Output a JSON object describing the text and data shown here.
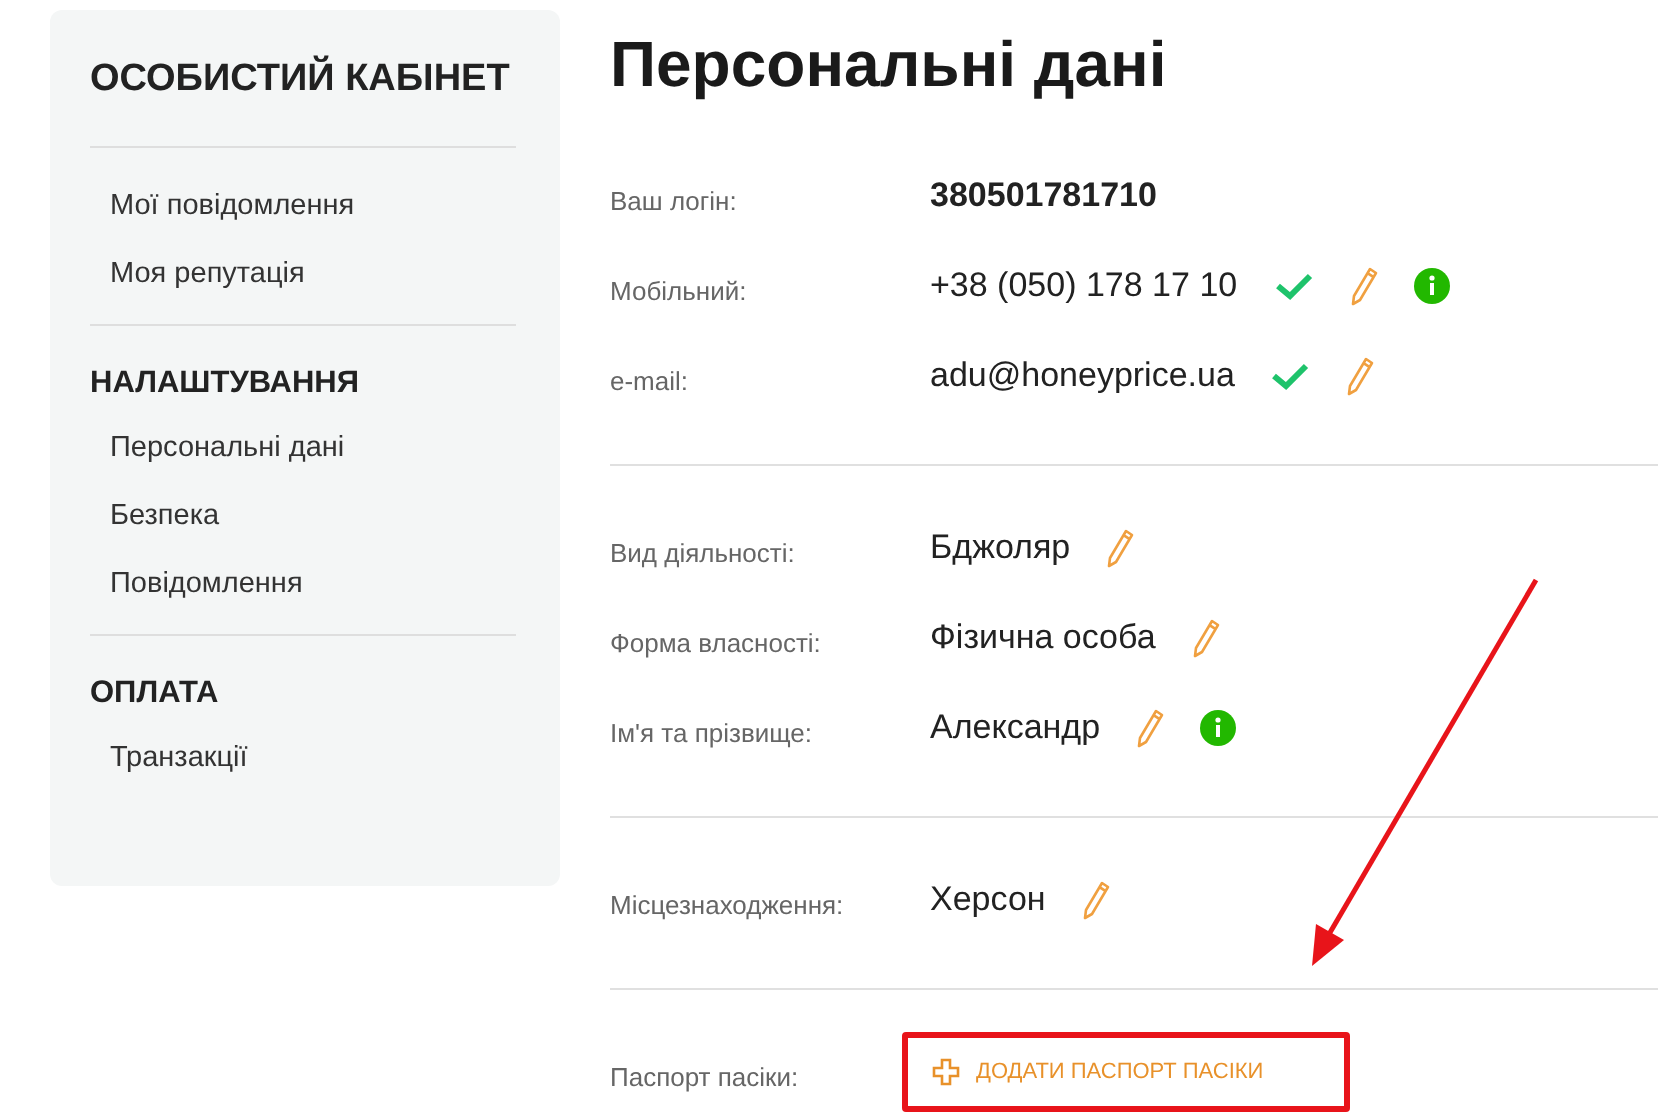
{
  "sidebar": {
    "title": "ОСОБИСТИЙ КАБІНЕТ",
    "groups": [
      {
        "items": [
          {
            "label": "Мої повідомлення"
          },
          {
            "label": "Моя репутація"
          }
        ]
      },
      {
        "title": "НАЛАШТУВАННЯ",
        "items": [
          {
            "label": "Персональні дані"
          },
          {
            "label": "Безпека"
          },
          {
            "label": "Повідомлення"
          }
        ]
      },
      {
        "title": "ОПЛАТА",
        "items": [
          {
            "label": "Транзакції"
          }
        ]
      }
    ]
  },
  "page": {
    "title": "Персональні дані",
    "sections": [
      {
        "rows": [
          {
            "kind": "text",
            "label": "Ваш логін:",
            "value": "380501781710",
            "bold": true,
            "verified": false,
            "editable": false,
            "info": false
          },
          {
            "kind": "text",
            "label": "Мобільний:",
            "value": "+38 (050) 178 17 10",
            "bold": false,
            "verified": true,
            "editable": true,
            "info": true
          },
          {
            "kind": "text",
            "label": "e-mail:",
            "value": "adu@honeyprice.ua",
            "bold": false,
            "verified": true,
            "editable": true,
            "info": false
          }
        ]
      },
      {
        "rows": [
          {
            "kind": "text",
            "label": "Вид діяльності:",
            "value": "Бджоляр",
            "bold": false,
            "verified": false,
            "editable": true,
            "info": false
          },
          {
            "kind": "text",
            "label": "Форма власності:",
            "value": "Фізична особа",
            "bold": false,
            "verified": false,
            "editable": true,
            "info": false
          },
          {
            "kind": "text",
            "label": "Ім'я та прізвище:",
            "value": "Александр",
            "bold": false,
            "verified": false,
            "editable": true,
            "info": true
          }
        ]
      },
      {
        "rows": [
          {
            "kind": "text",
            "label": "Місцезнаходження:",
            "value": "Херсон",
            "bold": false,
            "verified": false,
            "editable": true,
            "info": false
          }
        ]
      },
      {
        "rows": [
          {
            "kind": "action",
            "label": "Паспорт пасіки:",
            "button": "ДОДАТИ ПАСПОРТ ПАСІКИ",
            "highlighted": true
          }
        ]
      }
    ]
  }
}
